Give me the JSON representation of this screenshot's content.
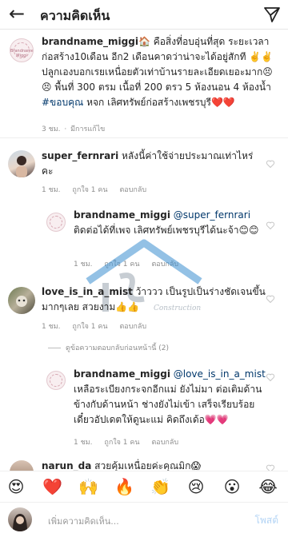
{
  "header": {
    "title": "ความคิดเห็น",
    "back_icon": "back-arrow-icon",
    "send_icon": "send-icon"
  },
  "caption": {
    "username": "brandname_miggi",
    "text": "🏠 คือสิ่งที่อบอุ่นที่สุด ระยะเวลาก่อสร้าง10เดือน อีก2 เดือนคาดว่าน่าจะได้อยู่สักที ✌️✌️ปลูกเองบอกเรยเหนื่อยตัวเท่าบ้านรายละเอียดเยอะมาก😣😣 พื้นที่ 300 ตรม เนื้อที่ 200 ตรว 5 ห้องนอน 4 ห้องน้ำ ",
    "hashtag": "#ขอบคุณ",
    "text_end": " หจก เลิศทรัพย์ก่อสร้างเพชรบุรี❤️❤️",
    "time": "3 ชม.",
    "edited": "มีการแก้ไข",
    "avatar_text": "Brandname Miggi"
  },
  "comments": [
    {
      "username": "super_fernrari",
      "text": " หลังนี้ค่าใช้จ่ายประมาณเท่าไหร่คะ",
      "time": "1 ชม.",
      "likes": "ถูกใจ 1 คน",
      "reply": "ตอบกลับ"
    },
    {
      "username": "brandname_miggi",
      "mention": " @super_fernrari",
      "text": " ติดต่อได้ที่เพจ เลิศทรัพย์เพชรบุรีได้นะจ้า😊😊",
      "time": "1 ชม.",
      "likes": "ถูกใจ 1 คน",
      "reply": "ตอบกลับ"
    },
    {
      "username": "love_is_in_a_mist",
      "text": " ว้าววว เป็นรูปเป็นร่างชัดเจนขึ้นมากๆเลย สวยงาม👍👍",
      "time": "1 ชม.",
      "likes": "ถูกใจ 1 คน",
      "reply": "ตอบกลับ"
    },
    {
      "username": "brandname_miggi",
      "mention": " @love_is_in_a_mist",
      "text": " เหลือระเบียงกระจกอีกแม่ ยังไม่มา ต่อเติมด้านข้างกับด้านหน้า ช่างยังไม่เข้า เสร็จเรียบร้อยเดี๋ยวอัปเดตให้ดูนะแม่ คิดถึงเด้อ💗💗",
      "time": "1 ชม.",
      "likes": "ถูกใจ 1 คน",
      "reply": "ตอบกลับ"
    },
    {
      "username": "narun_da",
      "text": " สวยคุ้มเหนื่อยค่ะคุณมิก😱"
    }
  ],
  "view_previous_replies": "ดูข้อความตอบกลับก่อนหน้านี้ (2)",
  "emojis": [
    "😍",
    "❤️",
    "🙌",
    "🔥",
    "👏",
    "😢",
    "😮",
    "😂"
  ],
  "input": {
    "placeholder": "เพิ่มความคิดเห็น...",
    "post_label": "โพสต์"
  },
  "watermark_text": "Construction",
  "colors": {
    "text": "#262626",
    "meta": "#8e8e8e",
    "hashtag": "#00376b",
    "mention": "#00376b",
    "post_disabled": "#b3d4f5",
    "heart_outline": "#c7c7c7"
  }
}
